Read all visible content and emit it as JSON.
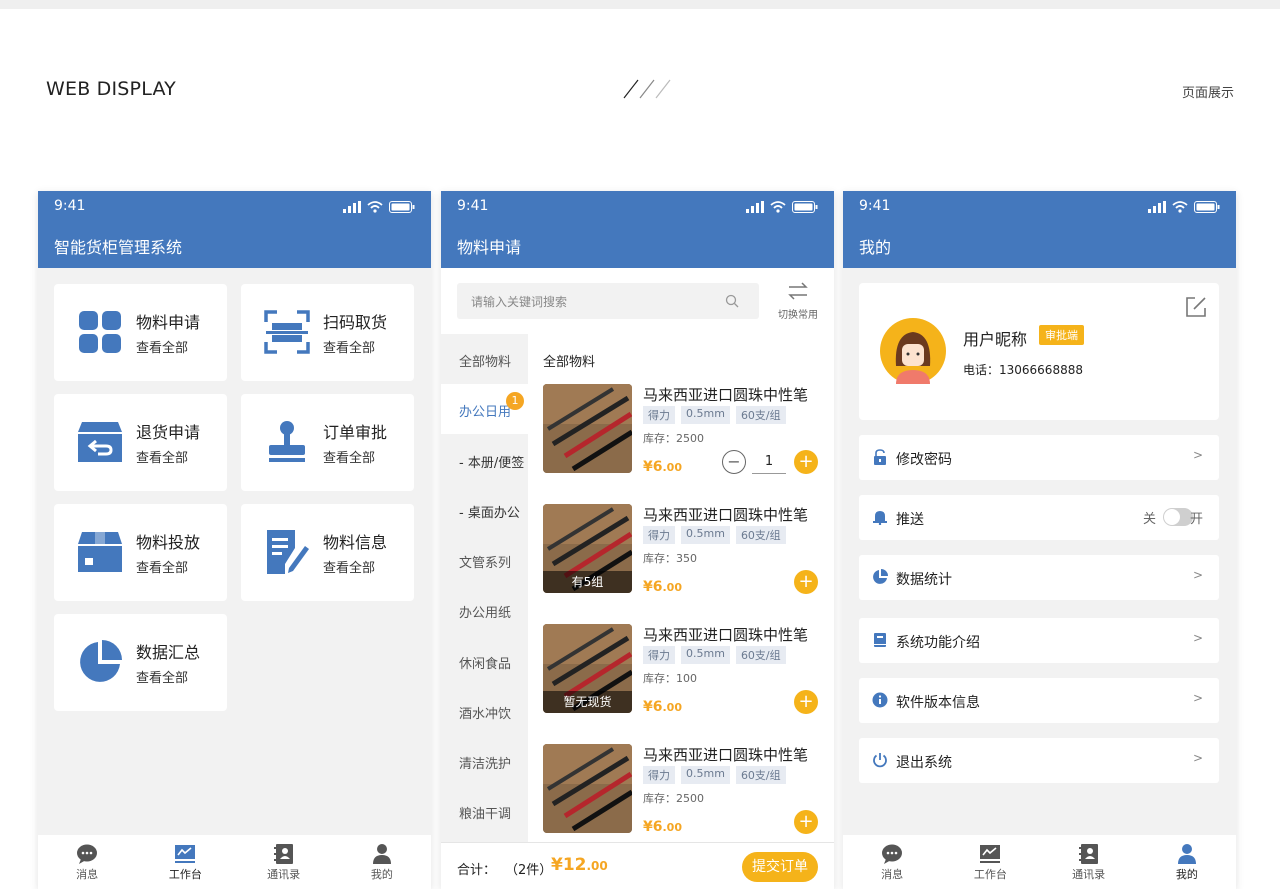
{
  "header": {
    "left": "WEB DISPLAY",
    "right": "页面展示"
  },
  "status": {
    "time": "9:41"
  },
  "colors": {
    "primary": "#4478bd",
    "accent": "#f5b31a",
    "background": "#f2f2f2"
  },
  "home": {
    "title": "智能货柜管理系统",
    "cards": [
      {
        "title": "物料申请",
        "sub": "查看全部",
        "icon": "grid-icon"
      },
      {
        "title": "扫码取货",
        "sub": "查看全部",
        "icon": "scan-icon"
      },
      {
        "title": "退货申请",
        "sub": "查看全部",
        "icon": "return-box-icon"
      },
      {
        "title": "订单审批",
        "sub": "查看全部",
        "icon": "stamp-icon"
      },
      {
        "title": "物料投放",
        "sub": "查看全部",
        "icon": "box-icon"
      },
      {
        "title": "物料信息",
        "sub": "查看全部",
        "icon": "edit-doc-icon"
      },
      {
        "title": "数据汇总",
        "sub": "查看全部",
        "icon": "pie-chart-icon"
      }
    ]
  },
  "tabs": [
    "消息",
    "工作台",
    "通讯录",
    "我的"
  ],
  "apply": {
    "title": "物料申请",
    "search_placeholder": "请输入关键词搜索",
    "switch_label": "切换常用",
    "categories": [
      {
        "label": "全部物料"
      },
      {
        "label": "办公日用",
        "badge": "1"
      },
      {
        "label": "- 本册/便签"
      },
      {
        "label": "- 桌面办公"
      },
      {
        "label": "文管系列"
      },
      {
        "label": "办公用纸"
      },
      {
        "label": "休闲食品"
      },
      {
        "label": "酒水冲饮"
      },
      {
        "label": "清洁洗护"
      },
      {
        "label": "粮油干调"
      }
    ],
    "list_head": "全部物料",
    "products": [
      {
        "name": "马来西亚进口圆珠中性笔",
        "tags": [
          "得力",
          "0.5mm",
          "60支/组"
        ],
        "stock": "库存：2500",
        "price": "¥6",
        "price_dec": ".00",
        "overlay": "",
        "qty": "1"
      },
      {
        "name": "马来西亚进口圆珠中性笔",
        "tags": [
          "得力",
          "0.5mm",
          "60支/组"
        ],
        "stock": "库存：350",
        "price": "¥6",
        "price_dec": ".00",
        "overlay": "有5组",
        "qty": ""
      },
      {
        "name": "马来西亚进口圆珠中性笔",
        "tags": [
          "得力",
          "0.5mm",
          "60支/组"
        ],
        "stock": "库存：100",
        "price": "¥6",
        "price_dec": ".00",
        "overlay": "暂无现货",
        "qty": ""
      },
      {
        "name": "马来西亚进口圆珠中性笔",
        "tags": [
          "得力",
          "0.5mm",
          "60支/组"
        ],
        "stock": "库存：2500",
        "price": "¥6",
        "price_dec": ".00",
        "overlay": "",
        "qty": ""
      }
    ],
    "bottom": {
      "label": "合计：",
      "count": "（2件）",
      "total": "¥12",
      "total_dec": ".00",
      "submit": "提交订单"
    }
  },
  "mine": {
    "title": "我的",
    "nickname": "用户昵称",
    "role": "审批端",
    "phone": "电话：13066668888",
    "menu": [
      {
        "label": "修改密码",
        "icon": "lock-icon"
      },
      {
        "label": "推送",
        "icon": "bell-icon",
        "off": "关",
        "on": "开"
      },
      {
        "label": "数据统计",
        "icon": "pie-icon"
      },
      {
        "label": "系统功能介绍",
        "icon": "book-icon"
      },
      {
        "label": "软件版本信息",
        "icon": "info-icon"
      },
      {
        "label": "退出系统",
        "icon": "power-icon"
      }
    ],
    "arrow": ">"
  }
}
